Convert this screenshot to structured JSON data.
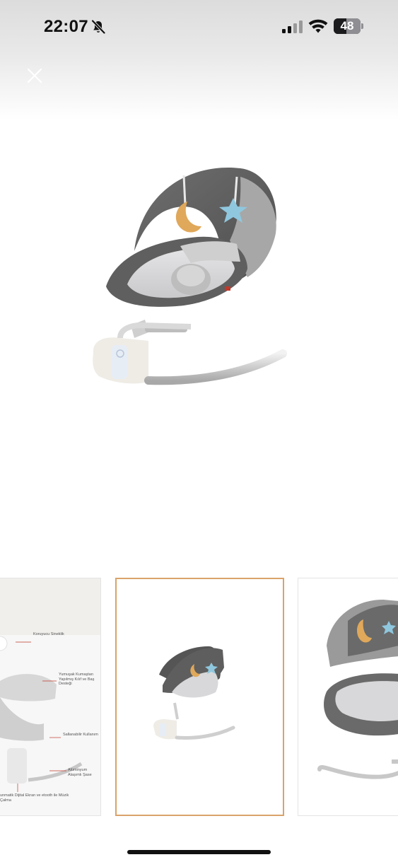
{
  "status_bar": {
    "time": "22:07",
    "battery_level": "48",
    "battery_fraction": 0.48,
    "icons": [
      "bell-slash-icon",
      "signal-icon",
      "wifi-icon",
      "battery-icon"
    ]
  },
  "header": {
    "close_icon": "close-icon"
  },
  "gallery": {
    "selected_index": 1,
    "selected_border_color": "#d9a36a",
    "thumbnails": [
      {
        "name": "features-diagram",
        "features": [
          "Koruyucu Sineklik",
          "Yumuşak Kumaştan Yapılmış Kılıf ve Baş Desteği",
          "Sallanabilir Kullanım",
          "Alüminyum Alaşımlı Şase",
          "unmatik Dijital Ekran ve etooth ile Müzik Çalma"
        ]
      },
      {
        "name": "product-front"
      },
      {
        "name": "product-exploded"
      }
    ]
  }
}
